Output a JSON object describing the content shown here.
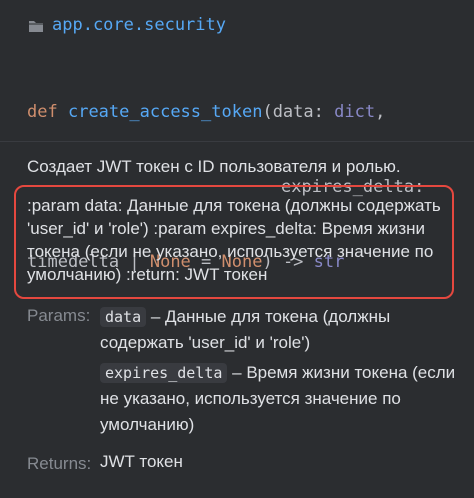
{
  "doc_popup": {
    "module": {
      "icon": "folder-icon",
      "path": "app.core.security"
    },
    "signature": {
      "def_keyword": "def",
      "function_name": "create_access_token",
      "open_paren": "(",
      "param1_name": "data",
      "colon1": ": ",
      "param1_type": "dict",
      "comma1": ",",
      "param2_name": "expires_delta",
      "colon2": ":",
      "param2_type": "timedelta",
      "pipe": " | ",
      "none_type": "None",
      "equals": " = ",
      "none_default": "None",
      "close_arrow": ") -> ",
      "return_type": "str"
    },
    "summary": "Создает JWT токен с ID пользователя и ролью.",
    "raw_docstring": ":param data: Данные для токена (должны содержать 'user_id' и 'role') :param expires_delta: Время жизни токена (если не указано, используется значение по умолчанию) :return: JWT токен",
    "params_section": {
      "label": "Params:",
      "items": [
        {
          "name": "data",
          "dash": " – ",
          "description": "Данные для токена (должны содержать 'user_id' и 'role')"
        },
        {
          "name": "expires_delta",
          "dash": " – ",
          "description": "Время жизни токена (если не указано, используется значение по умолчанию)"
        }
      ]
    },
    "returns_section": {
      "label": "Returns:",
      "value": "JWT токен"
    },
    "colors": {
      "background": "#2b2d30",
      "keyword": "#cf8e6d",
      "function": "#56a8f5",
      "type": "#8888c6",
      "highlight_border": "#e5483f"
    }
  }
}
